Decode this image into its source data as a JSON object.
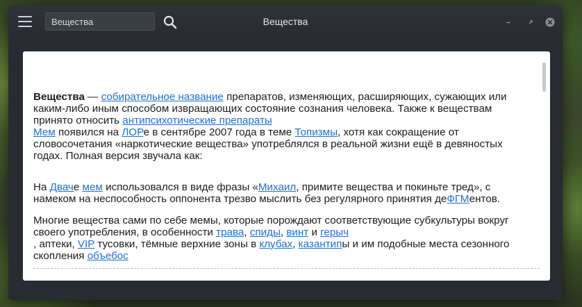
{
  "window": {
    "title": "Вещества",
    "search": {
      "value": "Вещества",
      "placeholder": "Вещества"
    }
  },
  "article": {
    "p1": {
      "term": "Вещества",
      "t1": " — ",
      "link1": "собирательное название",
      "t2": " препаратов, изменяющих, расширяющих, сужающих или каким-либо иным способом извращающих состояние сознания человека. Также к веществам принято относить ",
      "link2": "антипсихотические препараты",
      "link3": "Мем",
      "t3": " появился на ",
      "link4": "ЛОР",
      "t4": "е в сентябре 2007 года в теме ",
      "link5": "Топизмы",
      "t5": ", хотя как сокращение от словосочетания «наркотические вещества» употреблялся в реальной жизни ещё в девяностых годах. Полная версия звучала как:"
    },
    "p2": {
      "t1": "На ",
      "link1": "Двач",
      "t2": "е ",
      "link2": "мем",
      "t3": " использовался в виде фразы «",
      "link3": "Михаил",
      "t4": ", примите вещества и покиньте тред», с намеком на неспособность оппонента трезво мыслить без регулярного принятия де",
      "link4": "ФГМ",
      "t5": "ентов."
    },
    "p3": {
      "t1": "Многие вещества сами по себе мемы, которые порождают соответствующие субкультуры вокруг своего употребления, в особенности ",
      "link1": "трава",
      "s1": ", ",
      "link2": "спиды",
      "s2": ", ",
      "link3": "винт",
      "s3": " и ",
      "link4": "герыч",
      "t2": ", аптеки, ",
      "link5": "VIP",
      "t3": " тусовки, тёмные верхние зоны в ",
      "link6": "клубах",
      "s4": ", ",
      "link7": "казантип",
      "t4": "ы и им подобные места сезонного скопления ",
      "link8": "объебос"
    }
  }
}
